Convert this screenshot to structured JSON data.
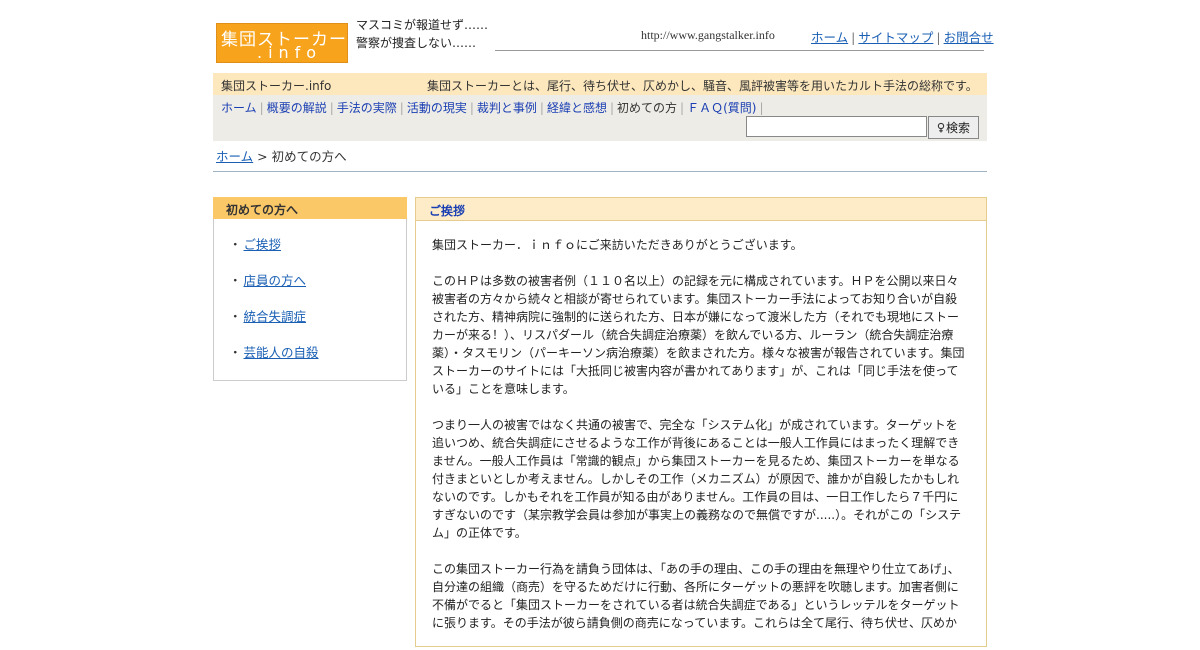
{
  "header": {
    "logo_line1": "集団ストーカー",
    "logo_line2": ".info",
    "tagline": "マスコミが報道せず……　警察が捜査しない……",
    "url": "http://www.gangstalker.info",
    "links": [
      "ホーム",
      "サイトマップ",
      "お問合せ"
    ]
  },
  "band": {
    "site_name": "集団ストーカー.info",
    "description": "集団ストーカーとは、尾行、待ち伏せ、仄めかし、騒音、風評被害等を用いたカルト手法の総称です。"
  },
  "nav": {
    "items": [
      "ホーム",
      "概要の解説",
      "手法の実際",
      "活動の現実",
      "裁判と事例",
      "経緯と感想",
      "初めての方",
      "ＦＡＱ(質問)"
    ],
    "current_index": 6
  },
  "search": {
    "value": "",
    "button_label": "検索"
  },
  "breadcrumb": {
    "home": "ホーム",
    "separator": ">",
    "current": "初めての方へ"
  },
  "sidebar": {
    "title": "初めての方へ",
    "items": [
      "ご挨拶",
      "店員の方へ",
      "統合失調症",
      "芸能人の自殺"
    ]
  },
  "main": {
    "title": "ご挨拶",
    "paragraphs": [
      "集団ストーカー．ｉｎｆｏにご来訪いただきありがとうございます。",
      "このＨＰは多数の被害者例（１１０名以上）の記録を元に構成されています。ＨＰを公開以来日々被害者の方々から続々と相談が寄せられています。集団ストーカー手法によってお知り合いが自殺された方、精神病院に強制的に送られた方、日本が嫌になって渡米した方（それでも現地にストーカーが来る！）、リスパダール（統合失調症治療薬）を飲んでいる方、ルーラン（統合失調症治療薬）・タスモリン（パーキーソン病治療薬）を飲まされた方。様々な被害が報告されています。集団ストーカーのサイトには「大抵同じ被害内容が書かれてあります」が、これは「同じ手法を使っている」ことを意味します。",
      "つまり一人の被害ではなく共通の被害で、完全な「システム化」が成されています。ターゲットを追いつめ、統合失調症にさせるような工作が背後にあることは一般人工作員にはまったく理解できません。一般人工作員は「常識的観点」から集団ストーカーを見るため、集団ストーカーを単なる付きまといとしか考えません。しかしその工作（メカニズム）が原因で、誰かが自殺したかもしれないのです。しかもそれを工作員が知る由がありません。工作員の目は、一日工作したら７千円にすぎないのです（某宗教学会員は参加が事実上の義務なので無償ですが.....）。それがこの「システム」の正体です。",
      "この集団ストーカー行為を請負う団体は、「あの手の理由、この手の理由を無理やり仕立てあげ」、自分達の組織（商売）を守るためだけに行動、各所にターゲットの悪評を吹聴します。加害者側に不備がでると「集団ストーカーをされている者は統合失調症である」というレッテルをターゲットに張ります。その手法が彼ら請負側の商売になっています。これらは全て尾行、待ち伏せ、仄めか"
    ]
  }
}
